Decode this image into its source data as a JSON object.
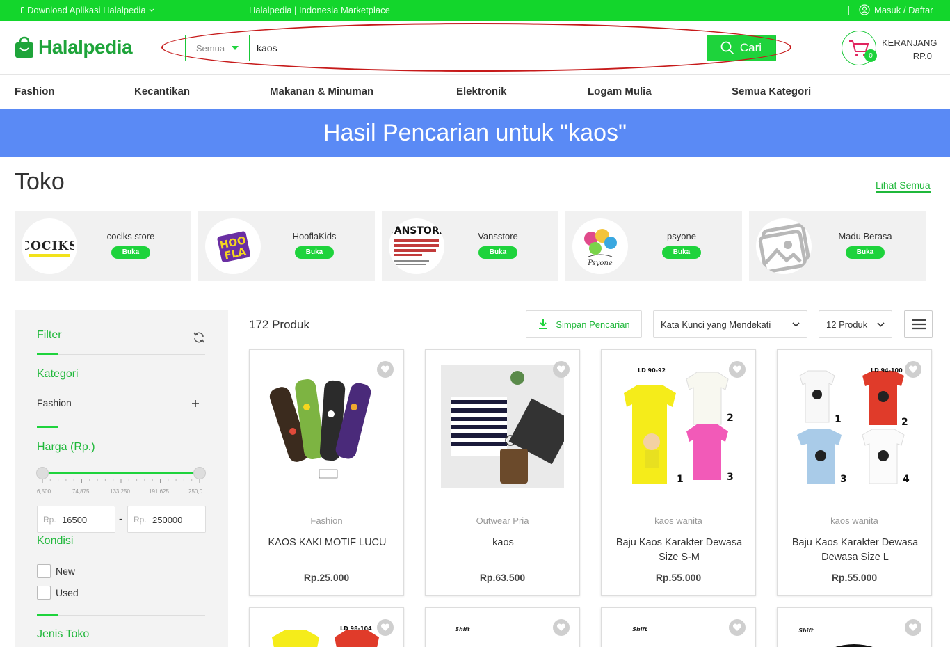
{
  "topbar": {
    "download_label": "Download Aplikasi Halalpedia",
    "tagline": "Halalpedia | Indonesia Marketplace",
    "login_label": "Masuk / Daftar"
  },
  "header": {
    "logo_text": "Halalpedia",
    "search": {
      "category": "Semua",
      "value": "kaos",
      "button_label": "Cari"
    },
    "cart": {
      "badge": "0",
      "label": "KERANJANG",
      "total": "RP.0"
    }
  },
  "nav": {
    "items": [
      "Fashion",
      "Kecantikan",
      "Makanan & Minuman",
      "Elektronik",
      "Logam Mulia",
      "Semua Kategori"
    ]
  },
  "banner": {
    "text": "Hasil Pencarian untuk \"kaos\""
  },
  "toko": {
    "title": "Toko",
    "see_all": "Lihat Semua",
    "stores": [
      {
        "name": "cociks store",
        "status": "Buka"
      },
      {
        "name": "HooflaKids",
        "status": "Buka"
      },
      {
        "name": "Vansstore",
        "status": "Buka"
      },
      {
        "name": "psyone",
        "status": "Buka"
      },
      {
        "name": "Madu Berasa",
        "status": "Buka"
      }
    ]
  },
  "filter": {
    "title": "Filter",
    "kategori_title": "Kategori",
    "kategori_item": "Fashion",
    "harga_title": "Harga (Rp.)",
    "tick_labels": [
      "6,500",
      "74,875",
      "133,250",
      "191,625",
      "250,0"
    ],
    "min_currency": "Rp.",
    "min_value": "16500",
    "max_currency": "Rp.",
    "max_value": "250000",
    "kondisi_title": "Kondisi",
    "kondisi_options": [
      "New",
      "Used"
    ],
    "jenis_toko_title": "Jenis Toko"
  },
  "products": {
    "count": "172 Produk",
    "save_search": "Simpan Pencarian",
    "sort": "Kata Kunci yang Mendekati",
    "per_page": "12 Produk",
    "items": [
      {
        "category": "Fashion",
        "title": "KAOS KAKI MOTIF LUCU",
        "price": "Rp.25.000"
      },
      {
        "category": "Outwear Pria",
        "title": "kaos",
        "price": "Rp.63.500"
      },
      {
        "category": "kaos wanita",
        "title": "Baju Kaos Karakter Dewasa Size S-M",
        "price": "Rp.55.000"
      },
      {
        "category": "kaos wanita",
        "title": "Baju Kaos Karakter Dewasa Dewasa Size L",
        "price": "Rp.55.000"
      }
    ]
  },
  "colors": {
    "brand_green": "#13d62c",
    "banner_blue": "#5a8af5",
    "highlight_red": "#c61a1a"
  }
}
